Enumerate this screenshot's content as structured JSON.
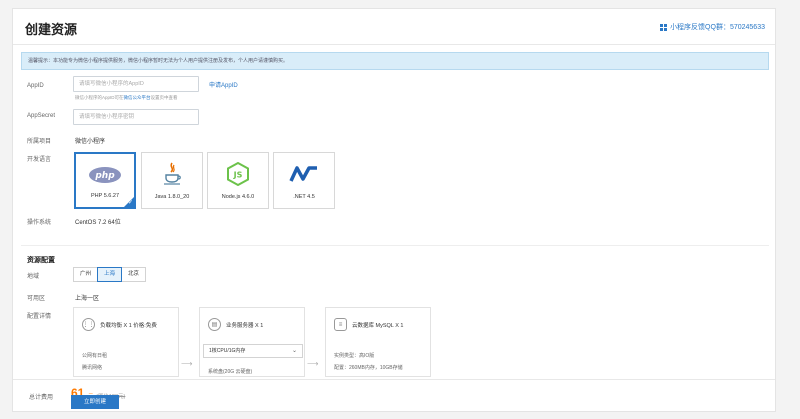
{
  "header": {
    "title": "创建资源",
    "qq_group": "小程序反馈QQ群：570245633"
  },
  "notice": "温馨提示：本功能专为微信小程序提供服务，微信小程序暂时无法为个人用户提供注册及发布，个人用户请谨慎购买。",
  "form": {
    "appid_label": "AppID",
    "appid_placeholder": "请填写微信小程序的AppID",
    "apply_appid_link": "申请AppID",
    "appid_hint_prefix": "微信小程序的AppID可在",
    "appid_hint_link": "微信公众平台",
    "appid_hint_suffix": "设置页中查看",
    "appsecret_label": "AppSecret",
    "appsecret_placeholder": "请填写微信小程序密钥",
    "project_label": "所属项目",
    "project_value": "微信小程序",
    "lang_label": "开发语言",
    "languages": [
      {
        "name": "PHP 5.6.27",
        "icon": "php-icon",
        "selected": true
      },
      {
        "name": "Java 1.8.0_20",
        "icon": "java-icon",
        "selected": false
      },
      {
        "name": "Node.js 4.6.0",
        "icon": "nodejs-icon",
        "selected": false
      },
      {
        "name": ".NET 4.5",
        "icon": "dotnet-icon",
        "selected": false
      }
    ],
    "os_label": "操作系统",
    "os_value": "CentOS 7.2 64位"
  },
  "resource": {
    "section_title": "资源配置",
    "region_label": "地域",
    "regions": [
      "广州",
      "上海",
      "北京"
    ],
    "active_region": "上海",
    "zone_label": "可用区",
    "zone_value": "上海一区",
    "config_label": "配置详情",
    "cards": [
      {
        "title": "负载均衡 X 1 价格:免费",
        "icon": "load-balancer-icon",
        "lines": [
          "公网有日租",
          "腾讯网络"
        ]
      },
      {
        "title": "业务服务器 X 1",
        "icon": "server-icon",
        "select": "1核CPU/1G内存",
        "lines": [
          "系统盘(20G 云硬盘)"
        ]
      },
      {
        "title": "云数据库 MySQL X 1",
        "icon": "database-icon",
        "lines": [
          "实例类型：高IO版",
          "配置：260MB内存，10GB存储"
        ]
      }
    ]
  },
  "footer": {
    "total_label": "总计费用",
    "price": "61",
    "unit": "元",
    "original_price": "(原价128元)",
    "buy_button": "立即创建"
  },
  "colors": {
    "accent": "#2a78c6",
    "price": "#ff7a00"
  }
}
